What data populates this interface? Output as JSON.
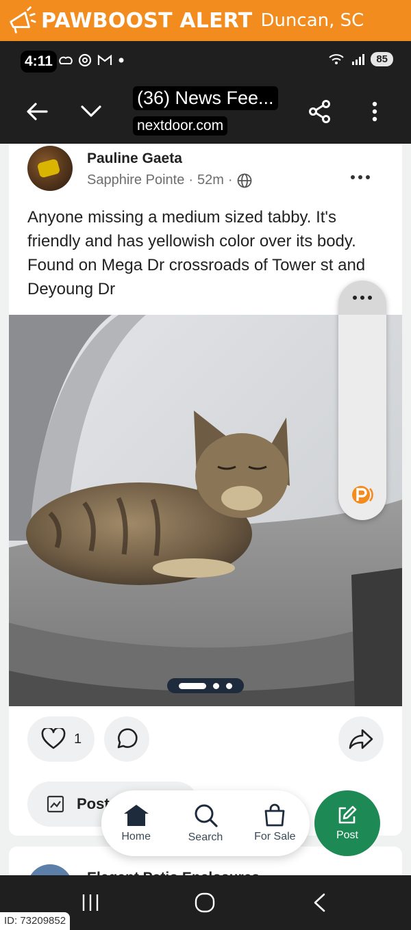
{
  "banner": {
    "title": "PAWBOOST ALERT",
    "location": "Duncan, SC"
  },
  "status_bar": {
    "time": "4:11",
    "battery": "85",
    "signal_label": "6"
  },
  "browser": {
    "tab_title": "(36) News Fee...",
    "url": "nextdoor.com"
  },
  "post": {
    "author": "Pauline Gaeta",
    "neighborhood": "Sapphire Pointe",
    "age": "52m",
    "text": "Anyone missing a medium sized tabby. It's friendly and has yellowish color over its body.  Found on Mega Dr crossroads of Tower st and Deyoung Dr",
    "like_count": "1",
    "post_button_label": "Post",
    "carousel_count": 3,
    "carousel_active_index": 0
  },
  "next_post": {
    "author": "Elegant Patio Enclosures"
  },
  "bottom_nav": {
    "items": [
      {
        "label": "Home",
        "icon": "home-icon"
      },
      {
        "label": "Search",
        "icon": "search-icon"
      },
      {
        "label": "For Sale",
        "icon": "shopping-bag-icon"
      }
    ],
    "post_label": "Post"
  },
  "footer": {
    "id": "ID: 73209852"
  },
  "colors": {
    "banner": "#f28c1e",
    "accent_green": "#1d8a55",
    "dark_bar": "#1f1f1f"
  }
}
